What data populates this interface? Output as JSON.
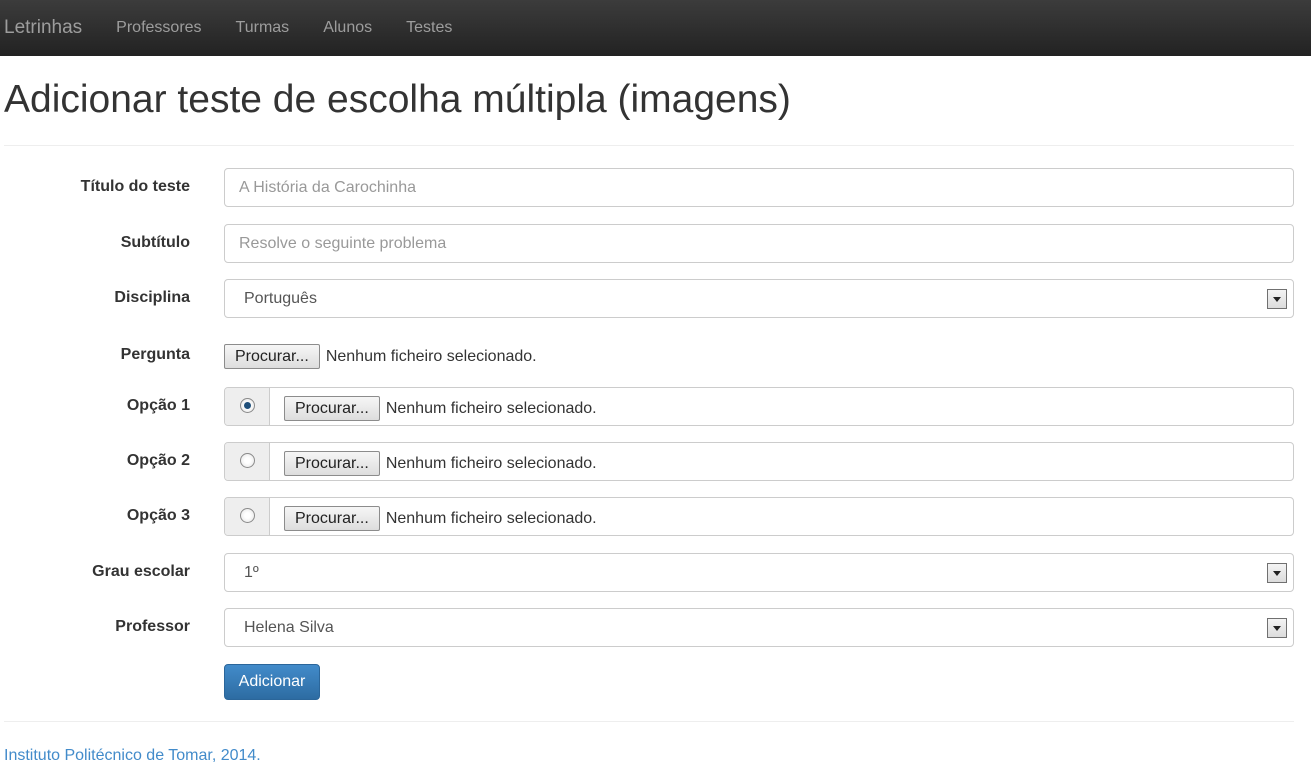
{
  "navbar": {
    "brand": "Letrinhas",
    "links": [
      "Professores",
      "Turmas",
      "Alunos",
      "Testes"
    ]
  },
  "page_title": "Adicionar teste de escolha múltipla (imagens)",
  "form": {
    "titulo": {
      "label": "Título do teste",
      "placeholder": "A História da Carochinha"
    },
    "subtitulo": {
      "label": "Subtítulo",
      "placeholder": "Resolve o seguinte problema"
    },
    "disciplina": {
      "label": "Disciplina",
      "value": "Português"
    },
    "pergunta": {
      "label": "Pergunta",
      "button": "Procurar...",
      "status": "Nenhum ficheiro selecionado."
    },
    "opcoes": [
      {
        "label": "Opção 1",
        "button": "Procurar...",
        "status": "Nenhum ficheiro selecionado.",
        "selected": true
      },
      {
        "label": "Opção 2",
        "button": "Procurar...",
        "status": "Nenhum ficheiro selecionado.",
        "selected": false
      },
      {
        "label": "Opção 3",
        "button": "Procurar...",
        "status": "Nenhum ficheiro selecionado.",
        "selected": false
      }
    ],
    "grau": {
      "label": "Grau escolar",
      "value": "1º"
    },
    "professor": {
      "label": "Professor",
      "value": "Helena Silva"
    },
    "submit": "Adicionar"
  },
  "footer": "Instituto Politécnico de Tomar, 2014.",
  "colors": {
    "primary": "#428bca",
    "navbar": "#222222",
    "link": "#428bca"
  }
}
